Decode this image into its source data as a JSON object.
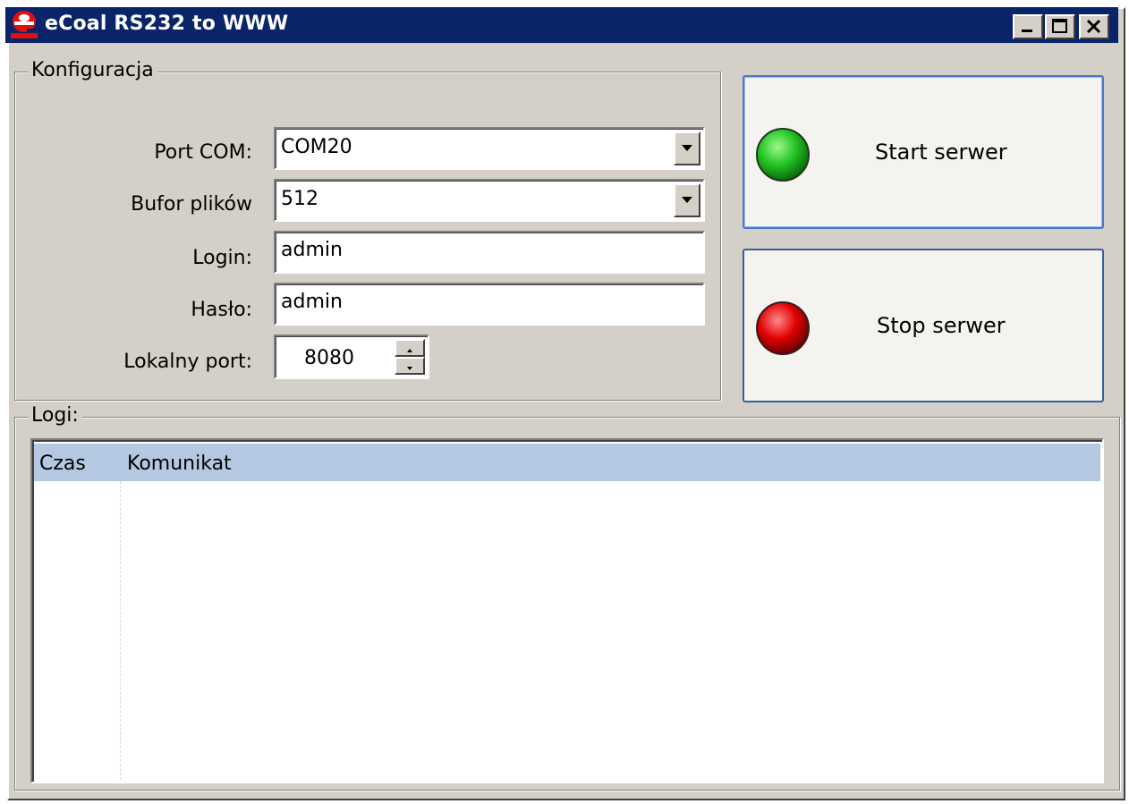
{
  "window": {
    "title": "eCoal RS232 to WWW",
    "controls": [
      "minimize-icon",
      "maximize-icon",
      "close-icon"
    ]
  },
  "config": {
    "legend": "Konfiguracja",
    "port_com": {
      "label": "Port COM:",
      "value": "COM20"
    },
    "bufor": {
      "label": "Bufor plików",
      "value": "512"
    },
    "login": {
      "label": "Login:",
      "value": "admin"
    },
    "haslo": {
      "label": "Hasło:",
      "value": "admin"
    },
    "lokalny_port": {
      "label": "Lokalny port:",
      "value": "8080"
    }
  },
  "actions": {
    "start": {
      "label": "Start serwer",
      "indicator_color": "#22c322"
    },
    "stop": {
      "label": "Stop serwer",
      "indicator_color": "#e00000"
    }
  },
  "logs": {
    "legend": "Logi:",
    "columns": [
      "Czas",
      "Komunikat"
    ],
    "rows": []
  },
  "colors": {
    "titlebar": "#0a246a",
    "face": "#d4d0c8",
    "header": "#b4c8e1"
  }
}
